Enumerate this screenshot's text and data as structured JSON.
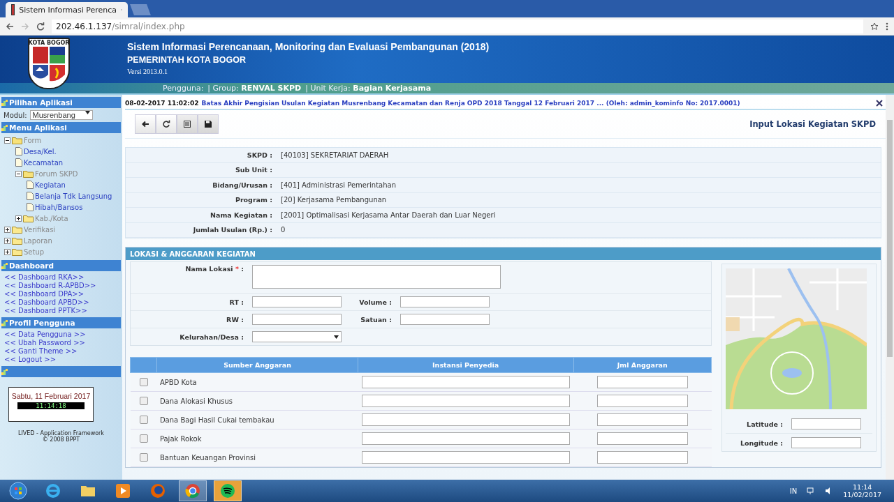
{
  "browser": {
    "tab_title": "Sistem Informasi Perenca",
    "url_host": "202.46.1.137",
    "url_path": "/simral/index.php"
  },
  "header": {
    "logo_label": "KOTA BOGOR",
    "title": "Sistem Informasi Perencanaan, Monitoring dan Evaluasi Pembangunan (2018)",
    "subtitle": "PEMERINTAH KOTA BOGOR",
    "version": "Versi 2013.0.1",
    "user_bar": [
      {
        "label": "Pengguna:"
      },
      {
        "label": "| Group:",
        "value": "RENVAL SKPD"
      },
      {
        "label": "| Unit Kerja:",
        "value": "Bagian Kerjasama"
      }
    ]
  },
  "sidebar": {
    "pilihan_title": "Pilihan Aplikasi",
    "modul_label": "Modul:",
    "modul_value": "Musrenbang",
    "menu_title": "Menu Aplikasi",
    "tree": [
      {
        "label": "Form",
        "expanded": true,
        "children": [
          {
            "label": "Desa/Kel."
          },
          {
            "label": "Kecamatan"
          },
          {
            "label": "Forum SKPD",
            "expanded": true,
            "children": [
              {
                "label": "Kegiatan"
              },
              {
                "label": "Belanja Tdk Langsung"
              },
              {
                "label": "Hibah/Bansos"
              }
            ]
          },
          {
            "label": "Kab./Kota",
            "expanded": false
          }
        ]
      },
      {
        "label": "Verifikasi",
        "expanded": false
      },
      {
        "label": "Laporan",
        "expanded": false
      },
      {
        "label": "Setup",
        "expanded": false
      }
    ],
    "dashboard_title": "Dashboard",
    "dashboard_links": [
      "<< Dashboard RKA>>",
      "<< Dashboard R-APBD>>",
      "<< Dashboard DPA>>",
      "<< Dashboard APBD>>",
      "<< Dashboard PPTK>>"
    ],
    "profil_title": "Profil Pengguna",
    "profil_links": [
      "<< Data Pengguna >>",
      "<< Ubah Password >>",
      "<< Ganti Theme >>",
      "<< Logout >>"
    ],
    "date": "Sabtu, 11 Februari 2017",
    "time": "11:14:18",
    "footer": [
      "LIVED - Application Framework",
      "© 2008 BPPT"
    ]
  },
  "notice": {
    "stamp": "08-02-2017 11:02:02",
    "text": "Batas Akhir Pengisian Usulan Kegiatan Musrenbang Kecamatan dan Renja OPD 2018 Tanggal 12 Februari 2017 ... (Oleh: admin_kominfo No: 2017.0001)"
  },
  "page_title": "Input Lokasi Kegiatan SKPD",
  "info": [
    {
      "label": "SKPD :",
      "value": "[40103] SEKRETARIAT DAERAH"
    },
    {
      "label": "Sub Unit :"
    },
    {
      "label": "Bidang/Urusan :",
      "value": "[401] Administrasi Pemerintahan"
    },
    {
      "label": "Program :",
      "value": "[20] Kerjasama Pembangunan"
    },
    {
      "label": "Nama Kegiatan :",
      "value": "[2001] Optimalisasi Kerjasama Antar Daerah dan Luar Negeri"
    },
    {
      "label": "Jumlah Usulan (Rp.) :",
      "value": "0"
    }
  ],
  "section_title": "LOKASI & ANGGARAN KEGIATAN",
  "form": {
    "nama_lokasi": "Nama Lokasi",
    "required_mark": "*",
    "label_suffix": ":",
    "rt": "RT :",
    "volume": "Volume :",
    "rw": "RW :",
    "satuan": "Satuan :",
    "kelurahan": "Kelurahan/Desa :",
    "latitude": "Latitude :",
    "longitude": "Longitude :"
  },
  "budget": {
    "columns": [
      "Sumber Anggaran",
      "Instansi Penyedia",
      "Jml Anggaran"
    ],
    "rows": [
      {
        "name": "APBD Kota",
        "checked": false
      },
      {
        "name": "Dana Alokasi Khusus",
        "checked": false
      },
      {
        "name": "Dana Bagi Hasil Cukai tembakau",
        "checked": false
      },
      {
        "name": "Pajak Rokok",
        "checked": false
      },
      {
        "name": "Bantuan Keuangan Provinsi",
        "checked": false
      }
    ]
  },
  "taskbar": {
    "lang": "IN",
    "time": "11:14",
    "date": "11/02/2017"
  }
}
